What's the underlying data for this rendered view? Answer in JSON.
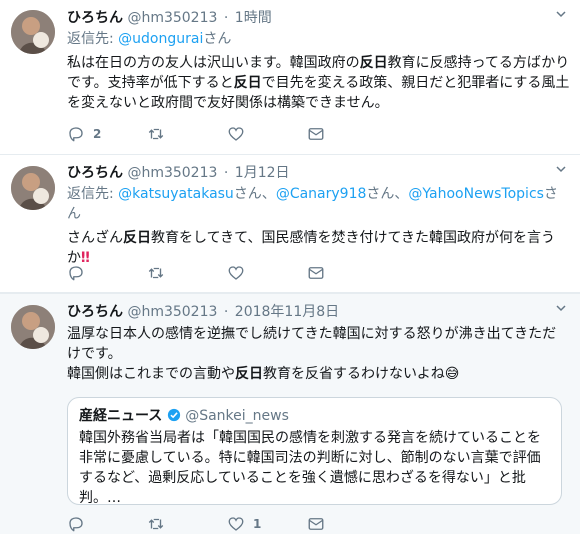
{
  "tweets": [
    {
      "name": "ひろちん",
      "handle": "@hm350213",
      "time": "1時間",
      "reply_label": "返信先:",
      "reply_mention": "@udongurai",
      "reply_suffix": "さん",
      "text_parts": [
        "私は在日の方の友人は沢山います。韓国政府の",
        "反日",
        "教育に反感持ってる方ばかりです。支持率が低下すると",
        "反日",
        "で目先を変える政策、親日だと犯罪者にする風土を変えないと政府間で友好関係は構築できません。"
      ],
      "reply_count": "2"
    },
    {
      "name": "ひろちん",
      "handle": "@hm350213",
      "time": "1月12日",
      "reply_label": "返信先:",
      "mentions": [
        "@katsuyatakasu",
        "さん、",
        "@Canary918",
        "さん、",
        "@YahooNewsTopics",
        "さん"
      ],
      "text_parts": [
        "さんざん",
        "反日",
        "教育をしてきて、国民感情を焚き付けてきた韓国政府が何を言うか"
      ],
      "emoji": "‼"
    },
    {
      "name": "ひろちん",
      "handle": "@hm350213",
      "time": "2018年11月8日",
      "text_line1": "温厚な日本人の感情を逆撫でし続けてきた韓国に対する怒りが沸き出てきただけです。",
      "text_parts": [
        "韓国側はこれまでの言動や",
        "反日",
        "教育を反省するわけないよね"
      ],
      "emoji": "😅",
      "like_count": "1",
      "quote": {
        "name": "産経ニュース",
        "handle": "@Sankei_news",
        "text": "韓国外務省当局者は「韓国国民の感情を刺激する発言を続けていることを非常に憂慮している。特に韓国司法の判断に対し、節制のない言葉で評価するなど、過剰反応していることを強く遺憾に思わざるを得ない」と批判。…"
      }
    }
  ],
  "colors": {
    "link": "#1da1f2",
    "muted": "#657786",
    "verified": "#1da1f2"
  }
}
